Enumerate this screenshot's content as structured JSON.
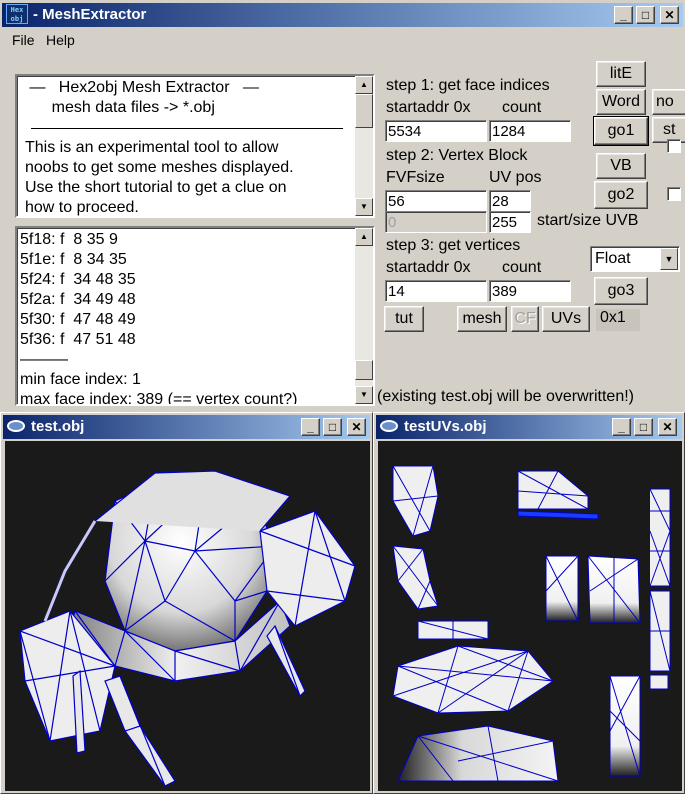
{
  "window": {
    "title": "- MeshExtractor",
    "icon_text": "Hex\nobj",
    "minimize": "_",
    "maximize": "□",
    "close": "✕"
  },
  "menu": {
    "file": "File",
    "help": "Help"
  },
  "info_panel": {
    "lines": [
      " —   Hex2obj Mesh Extractor   —",
      "      mesh data files -> *.obj",
      "",
      "This is an experimental tool to allow",
      "noobs to get some meshes displayed.",
      "Use the short tutorial to get a clue on",
      "how to proceed."
    ]
  },
  "output_panel": {
    "lines": [
      "5f18: f  8 35 9",
      "5f1e: f  8 34 35",
      "5f24: f  34 48 35",
      "5f2a: f  34 49 48",
      "5f30: f  47 48 49",
      "5f36: f  47 51 48",
      "———",
      "min face index: 1",
      "max face index: 389 (== vertex count?)"
    ]
  },
  "step1": {
    "title": "step 1: get face indices",
    "startaddr_label": "startaddr 0x",
    "count_label": "count",
    "startaddr": "5534",
    "count": "1284",
    "go": "go1",
    "lite_button": "litE",
    "word_button": "Word"
  },
  "step2": {
    "title": "step 2: Vertex Block",
    "fvf_label": "FVFsize",
    "uvpos_label": "UV pos",
    "fvfsize": "56",
    "uvpos": "28",
    "uvb_start": "0",
    "uvb_size": "255",
    "uvb_label": "start/size UVB",
    "vb_button": "VB",
    "go": "go2"
  },
  "step3": {
    "title": "step 3: get vertices",
    "startaddr_label": "startaddr 0x",
    "count_label": "count",
    "startaddr": "14",
    "count": "389",
    "type_select": "Float",
    "go": "go3"
  },
  "right_partial": {
    "top": "no",
    "bottom": "st"
  },
  "bottom_buttons": {
    "tut": "tut",
    "mesh": "mesh",
    "cf": "CF",
    "uvs": "UVs",
    "offset": "0x1"
  },
  "status": "(existing test.obj will be overwritten!)",
  "viewer1": {
    "title": "test.obj"
  },
  "viewer2": {
    "title": "testUVs.obj"
  },
  "colors": {
    "wire": "#0000c8",
    "title_grad_start": "#0a246a",
    "title_grad_end": "#a6caf0"
  }
}
